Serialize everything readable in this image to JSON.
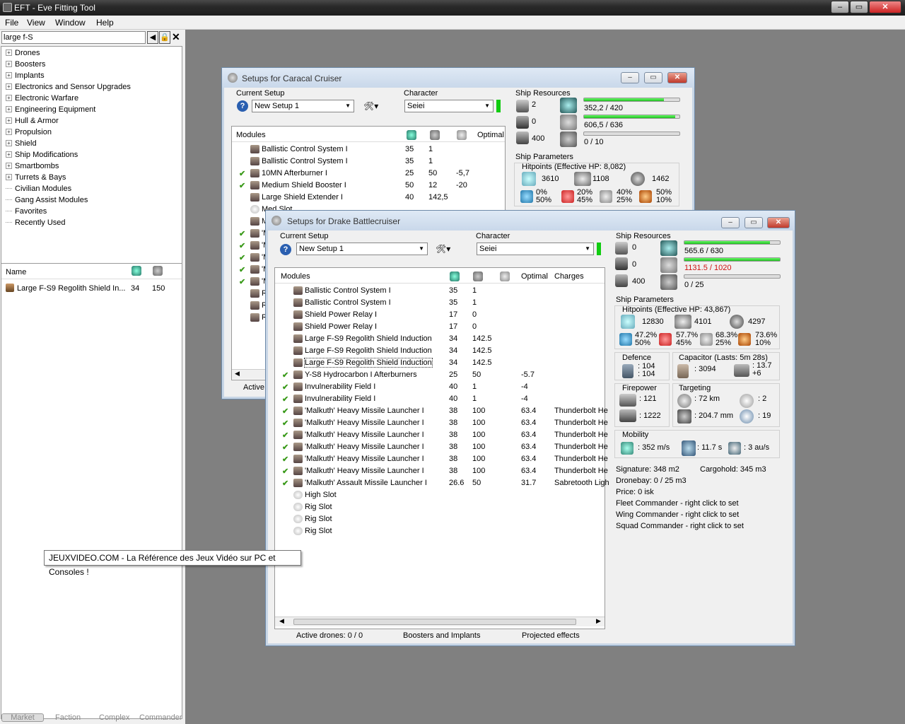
{
  "app": {
    "title": "EFT - Eve Fitting Tool",
    "menu": [
      "File",
      "View",
      "Window",
      "Help"
    ]
  },
  "search": {
    "value": "large f-S"
  },
  "tree": [
    "Drones",
    "Boosters",
    "Implants",
    "Electronics and Sensor Upgrades",
    "Electronic Warfare",
    "Engineering Equipment",
    "Hull & Armor",
    "Propulsion",
    "Shield",
    "Ship Modifications",
    "Smartbombs",
    "Turrets & Bays",
    "Civilian Modules",
    "Gang Assist Modules",
    "Favorites",
    "Recently Used"
  ],
  "list": {
    "col_name": "Name",
    "rows": [
      {
        "name": "Large F-S9 Regolith Shield In...",
        "cpu": "34",
        "pg": "150"
      }
    ]
  },
  "bottom_tabs": [
    "Market",
    "Faction",
    "Complex",
    "Commander"
  ],
  "tooltip": "JEUXVIDEO.COM - La Référence des Jeux Vidéo sur PC et Consoles !",
  "caracal": {
    "title": "Setups for Caracal Cruiser",
    "current_setup_label": "Current Setup",
    "setup": "New Setup 1",
    "character_label": "Character",
    "character": "Seiei",
    "ship_resources": "Ship Resources",
    "hi": "2",
    "mid": "0",
    "calib": "400",
    "cpu": "352,2 / 420",
    "pg": "606,5 / 636",
    "drone": "0 / 10",
    "ship_params": "Ship Parameters",
    "hp_label": "Hitpoints (Effective HP: 8,082)",
    "shield": "3610",
    "armor": "1108",
    "hull": "1462",
    "r1": "0%",
    "r1b": "50%",
    "r2": "20%",
    "r2b": "45%",
    "r3": "40%",
    "r3b": "25%",
    "r4": "50%",
    "r4b": "10%",
    "active": "Active",
    "modules_hdr": "Modules",
    "optimal_hdr": "Optimal",
    "rows": [
      {
        "c": "",
        "n": "Ballistic Control System I",
        "cpu": "35",
        "pg": "1",
        "o": ""
      },
      {
        "c": "",
        "n": "Ballistic Control System I",
        "cpu": "35",
        "pg": "1",
        "o": ""
      },
      {
        "c": "✔",
        "n": "10MN Afterburner I",
        "cpu": "25",
        "pg": "50",
        "o": "-5,7"
      },
      {
        "c": "✔",
        "n": "Medium Shield Booster I",
        "cpu": "50",
        "pg": "12",
        "o": "-20"
      },
      {
        "c": "",
        "n": "Large Shield Extender I",
        "cpu": "40",
        "pg": "142,5",
        "o": ""
      },
      {
        "c": "",
        "n": "Med Slot",
        "cpu": "",
        "pg": "",
        "o": ""
      },
      {
        "c": "",
        "n": "M",
        "cpu": "",
        "pg": "",
        "o": ""
      },
      {
        "c": "✔",
        "n": "'M",
        "cpu": "",
        "pg": "",
        "o": ""
      },
      {
        "c": "✔",
        "n": "'M",
        "cpu": "",
        "pg": "",
        "o": ""
      },
      {
        "c": "✔",
        "n": "'M",
        "cpu": "",
        "pg": "",
        "o": ""
      },
      {
        "c": "✔",
        "n": "'M",
        "cpu": "",
        "pg": "",
        "o": ""
      },
      {
        "c": "✔",
        "n": "'M",
        "cpu": "",
        "pg": "",
        "o": ""
      },
      {
        "c": "",
        "n": "R",
        "cpu": "",
        "pg": "",
        "o": ""
      },
      {
        "c": "",
        "n": "R",
        "cpu": "",
        "pg": "",
        "o": ""
      },
      {
        "c": "",
        "n": "R",
        "cpu": "",
        "pg": "",
        "o": ""
      }
    ]
  },
  "drake": {
    "title": "Setups for Drake Battlecruiser",
    "current_setup_label": "Current Setup",
    "setup": "New Setup 1",
    "character_label": "Character",
    "character": "Seiei",
    "ship_resources": "Ship Resources",
    "hi": "0",
    "mid": "0",
    "calib": "400",
    "cpu": "565.6 / 630",
    "pg": "1131.5 / 1020",
    "drone": "0 / 25",
    "ship_params": "Ship Parameters",
    "hp_label": "Hitpoints (Effective HP: 43,867)",
    "shield": "12830",
    "armor": "4101",
    "hull": "4297",
    "r1": "47.2%",
    "r1b": "50%",
    "r2": "57.7%",
    "r2b": "45%",
    "r3": "68.3%",
    "r3b": "25%",
    "r4": "73.6%",
    "r4b": "10%",
    "defence_label": "Defence",
    "def1": ": 104",
    "def2": ": 104",
    "cap_label": "Capacitor (Lasts: 5m 28s)",
    "cap": ": 3094",
    "cap2": ": 13.7",
    "cap3": "+6",
    "fire_label": "Firepower",
    "fp1": ": 121",
    "fp2": ": 1222",
    "tgt_label": "Targeting",
    "tg1": ": 72 km",
    "tg2": ": 204.7 mm",
    "tg3": ": 2",
    "tg4": ": 19",
    "mob_label": "Mobility",
    "mob1": ": 352 m/s",
    "mob2": ": 11.7 s",
    "mob3": ": 3 au/s",
    "sig": "Signature: 348 m2",
    "cargo": "Cargohold: 345 m3",
    "dronebay": "Dronebay: 0 / 25 m3",
    "price": "Price: 0 isk",
    "fleet": "Fleet Commander - right click to set",
    "wing": "Wing Commander - right click to set",
    "squad": "Squad Commander - right click to set",
    "modules_hdr": "Modules",
    "optimal_hdr": "Optimal",
    "charges_hdr": "Charges",
    "footer": {
      "drones": "Active drones: 0 / 0",
      "boosters": "Boosters and Implants",
      "projected": "Projected effects"
    },
    "rows": [
      {
        "c": "",
        "n": "Ballistic Control System I",
        "cpu": "35",
        "pg": "1",
        "o": "",
        "ch": ""
      },
      {
        "c": "",
        "n": "Ballistic Control System I",
        "cpu": "35",
        "pg": "1",
        "o": "",
        "ch": ""
      },
      {
        "c": "",
        "n": "Shield Power Relay I",
        "cpu": "17",
        "pg": "0",
        "o": "",
        "ch": ""
      },
      {
        "c": "",
        "n": "Shield Power Relay I",
        "cpu": "17",
        "pg": "0",
        "o": "",
        "ch": ""
      },
      {
        "c": "",
        "n": "Large F-S9 Regolith Shield Induction",
        "cpu": "34",
        "pg": "142.5",
        "o": "",
        "ch": ""
      },
      {
        "c": "",
        "n": "Large F-S9 Regolith Shield Induction",
        "cpu": "34",
        "pg": "142.5",
        "o": "",
        "ch": ""
      },
      {
        "c": "",
        "n": "Large F-S9 Regolith Shield Induction",
        "cpu": "34",
        "pg": "142.5",
        "o": "",
        "ch": ""
      },
      {
        "c": "✔",
        "n": "Y-S8 Hydrocarbon I Afterburners",
        "cpu": "25",
        "pg": "50",
        "o": "-5.7",
        "ch": ""
      },
      {
        "c": "✔",
        "n": "Invulnerability Field I",
        "cpu": "40",
        "pg": "1",
        "o": "-4",
        "ch": ""
      },
      {
        "c": "✔",
        "n": "Invulnerability Field I",
        "cpu": "40",
        "pg": "1",
        "o": "-4",
        "ch": ""
      },
      {
        "c": "✔",
        "n": "'Malkuth' Heavy Missile Launcher I",
        "cpu": "38",
        "pg": "100",
        "o": "63.4",
        "ch": "Thunderbolt He"
      },
      {
        "c": "✔",
        "n": "'Malkuth' Heavy Missile Launcher I",
        "cpu": "38",
        "pg": "100",
        "o": "63.4",
        "ch": "Thunderbolt He"
      },
      {
        "c": "✔",
        "n": "'Malkuth' Heavy Missile Launcher I",
        "cpu": "38",
        "pg": "100",
        "o": "63.4",
        "ch": "Thunderbolt He"
      },
      {
        "c": "✔",
        "n": "'Malkuth' Heavy Missile Launcher I",
        "cpu": "38",
        "pg": "100",
        "o": "63.4",
        "ch": "Thunderbolt He"
      },
      {
        "c": "✔",
        "n": "'Malkuth' Heavy Missile Launcher I",
        "cpu": "38",
        "pg": "100",
        "o": "63.4",
        "ch": "Thunderbolt He"
      },
      {
        "c": "✔",
        "n": "'Malkuth' Heavy Missile Launcher I",
        "cpu": "38",
        "pg": "100",
        "o": "63.4",
        "ch": "Thunderbolt He"
      },
      {
        "c": "✔",
        "n": "'Malkuth' Assault Missile Launcher I",
        "cpu": "26.6",
        "pg": "50",
        "o": "31.7",
        "ch": "Sabretooth Ligh"
      },
      {
        "c": "",
        "n": "High Slot",
        "cpu": "",
        "pg": "",
        "o": "",
        "ch": ""
      },
      {
        "c": "",
        "n": "Rig Slot",
        "cpu": "",
        "pg": "",
        "o": "",
        "ch": ""
      },
      {
        "c": "",
        "n": "Rig Slot",
        "cpu": "",
        "pg": "",
        "o": "",
        "ch": ""
      },
      {
        "c": "",
        "n": "Rig Slot",
        "cpu": "",
        "pg": "",
        "o": "",
        "ch": ""
      }
    ]
  }
}
